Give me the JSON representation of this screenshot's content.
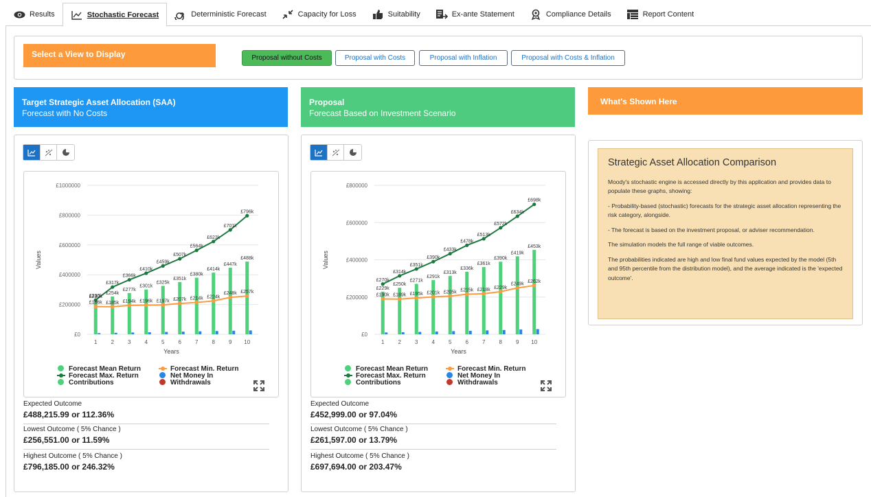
{
  "tabs": [
    {
      "label": "Results",
      "icon": "eye-icon"
    },
    {
      "label": "Stochastic Forecast",
      "icon": "line-chart-icon",
      "active": true
    },
    {
      "label": "Deterministic Forecast",
      "icon": "spiral-icon"
    },
    {
      "label": "Capacity for Loss",
      "icon": "compress-arrows-icon"
    },
    {
      "label": "Suitability",
      "icon": "thumbs-up-icon"
    },
    {
      "label": "Ex-ante Statement",
      "icon": "document-arrow-icon"
    },
    {
      "label": "Compliance Details",
      "icon": "award-icon"
    },
    {
      "label": "Report Content",
      "icon": "table-icon"
    }
  ],
  "view_selector": {
    "title": "Select a View to Display",
    "buttons": [
      "Proposal without Costs",
      "Proposal with Costs",
      "Proposal with Inflation",
      "Proposal with Costs & Inflation"
    ],
    "selected": "Proposal without Costs"
  },
  "colors": {
    "accent_blue": "#1e96f4",
    "accent_green": "#4ecb7e",
    "accent_orange": "#fd9a3c",
    "mean": "#4fd07a",
    "max": "#1c7a3f",
    "min": "#fd9a3c",
    "money_in": "#2a86e6",
    "withdrawals": "#c0392b"
  },
  "saa": {
    "title": "Target Strategic Asset Allocation (SAA)",
    "subtitle": "Forecast with No Costs",
    "stats": [
      {
        "label": "Expected Outcome",
        "value": "£488,215.99 or 112.36%"
      },
      {
        "label": "Lowest Outcome ( 5% Chance )",
        "value": "£256,551.00 or 11.59%"
      },
      {
        "label": "Highest Outcome ( 5% Chance )",
        "value": "£796,185.00 or 246.32%"
      }
    ]
  },
  "proposal": {
    "title": "Proposal",
    "subtitle": "Forecast Based on Investment Scenario",
    "stats": [
      {
        "label": "Expected Outcome",
        "value": "£452,999.00 or 97.04%"
      },
      {
        "label": "Lowest Outcome ( 5% Chance )",
        "value": "£261,597.00 or 13.79%"
      },
      {
        "label": "Highest Outcome ( 5% Chance )",
        "value": "£697,694.00 or 203.47%"
      }
    ]
  },
  "legend": {
    "mean": "Forecast Mean Return",
    "min": "Forecast Min. Return",
    "max": "Forecast Max. Return",
    "net": "Net Money In",
    "contrib": "Contributions",
    "withdraw": "Withdrawals"
  },
  "chart_data": [
    {
      "type": "bar",
      "xlabel": "Years",
      "ylabel": "Values",
      "categories": [
        "1",
        "2",
        "3",
        "4",
        "5",
        "6",
        "7",
        "8",
        "9",
        "10"
      ],
      "ylim": [
        0,
        1000000
      ],
      "yticks": [
        "£0",
        "£200000",
        "£400000",
        "£600000",
        "£800000",
        "£1000000"
      ],
      "series": [
        {
          "name": "Forecast Mean Return",
          "type": "bar",
          "values": [
            230000,
            254000,
            277000,
            301000,
            325000,
            351000,
            380000,
            414000,
            447000,
            488000
          ],
          "labels": [
            "£230k",
            "£254k",
            "£277k",
            "£301k",
            "£325k",
            "£351k",
            "£380k",
            "£414k",
            "£447k",
            "£488k"
          ]
        },
        {
          "name": "Forecast Max. Return",
          "type": "line",
          "values": [
            230000,
            317000,
            366000,
            410000,
            459000,
            507000,
            564000,
            623000,
            701000,
            796000
          ],
          "labels": [
            "£230k",
            "£317k",
            "£366k",
            "£410k",
            "£459k",
            "£507k",
            "£564k",
            "£623k",
            "£701k",
            "£796k"
          ]
        },
        {
          "name": "Forecast Min. Return",
          "type": "line",
          "values": [
            186000,
            185000,
            194000,
            196000,
            197000,
            207000,
            214000,
            224000,
            248000,
            257000
          ],
          "labels": [
            "£186k",
            "£185k",
            "£194k",
            "£196k",
            "£197k",
            "£207k",
            "£214k",
            "£224k",
            "£248k",
            "£257k"
          ]
        },
        {
          "name": "Net Money In",
          "type": "bar",
          "values": [
            8000,
            10000,
            12000,
            14000,
            16000,
            18000,
            20000,
            22000,
            24000,
            26000
          ]
        }
      ]
    },
    {
      "type": "bar",
      "xlabel": "Years",
      "ylabel": "Values",
      "categories": [
        "1",
        "2",
        "3",
        "4",
        "5",
        "6",
        "7",
        "8",
        "9",
        "10"
      ],
      "ylim": [
        0,
        800000
      ],
      "yticks": [
        "£0",
        "£200000",
        "£400000",
        "£600000",
        "£800000"
      ],
      "series": [
        {
          "name": "Forecast Mean Return",
          "type": "bar",
          "values": [
            229000,
            250000,
            271000,
            291000,
            313000,
            336000,
            361000,
            390000,
            419000,
            453000
          ],
          "labels": [
            "£229k",
            "£250k",
            "£271k",
            "£291k",
            "£313k",
            "£336k",
            "£361k",
            "£390k",
            "£419k",
            "£453k"
          ]
        },
        {
          "name": "Forecast Max. Return",
          "type": "line",
          "values": [
            270000,
            314000,
            351000,
            390000,
            433000,
            478000,
            513000,
            572000,
            634000,
            698000
          ],
          "labels": [
            "£270k",
            "£314k",
            "£351k",
            "£390k",
            "£433k",
            "£478k",
            "£513k",
            "£572k",
            "£634k",
            "£698k"
          ]
        },
        {
          "name": "Forecast Min. Return",
          "type": "line",
          "values": [
            190000,
            189000,
            195000,
            201000,
            205000,
            215000,
            218000,
            229000,
            249000,
            262000
          ],
          "labels": [
            "£190k",
            "£189k",
            "£195k",
            "£201k",
            "£205k",
            "£215k",
            "£218k",
            "£229k",
            "£249k",
            "£262k"
          ]
        },
        {
          "name": "Net Money In",
          "type": "bar",
          "values": [
            10000,
            11000,
            13000,
            15000,
            17000,
            19000,
            21000,
            23000,
            26000,
            28000
          ]
        }
      ]
    }
  ],
  "whats_shown": {
    "title": "What's Shown Here",
    "heading": "Strategic Asset Allocation Comparison",
    "paragraphs": [
      "Moody's stochastic engine is accessed directly by this application and provides data to populate these graphs, showing:",
      "- Probability-based (stochastic) forecasts for the strategic asset allocation representing the risk category, alongside.",
      "- The forecast is based on the investment proposal, or adviser recommendation.",
      "The simulation models the full range of viable outcomes.",
      "The probabilities indicated are high and low final fund values expected by the model (5th and 95th percentile from the distribution model), and the average indicated is the 'expected outcome'."
    ]
  }
}
